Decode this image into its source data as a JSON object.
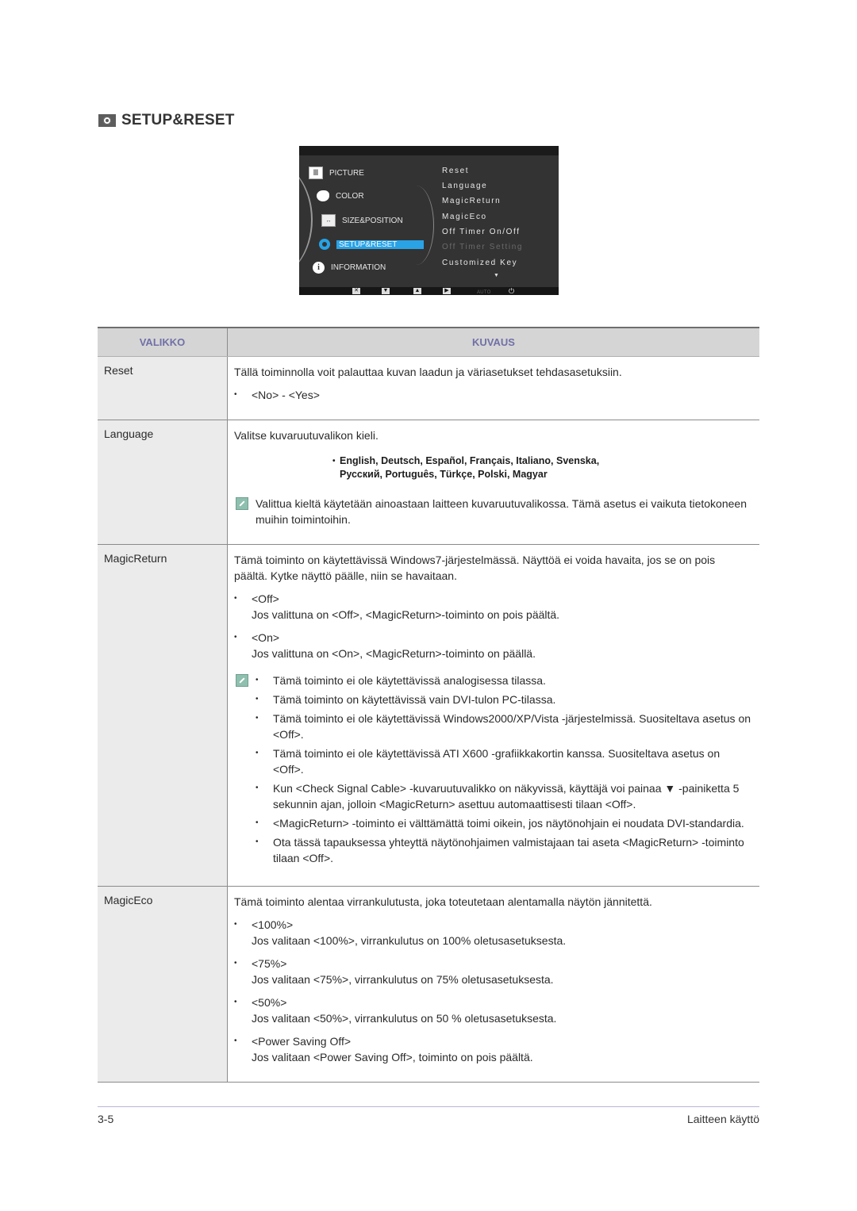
{
  "section": {
    "icon": "setup-gear-icon",
    "title": "SETUP&RESET"
  },
  "osd": {
    "menu": [
      {
        "label": "PICTURE",
        "icon": "picture-icon"
      },
      {
        "label": "COLOR",
        "icon": "palette-icon"
      },
      {
        "label": "SIZE&POSITION",
        "icon": "size-position-icon"
      },
      {
        "label": "SETUP&RESET",
        "icon": "gear-icon",
        "selected": true
      },
      {
        "label": "INFORMATION",
        "icon": "info-icon"
      }
    ],
    "submenu": [
      {
        "label": "Reset"
      },
      {
        "label": "Language"
      },
      {
        "label": "MagicReturn"
      },
      {
        "label": "MagicEco"
      },
      {
        "label": "Off Timer On/Off"
      },
      {
        "label": "Off Timer Setting",
        "disabled": true
      },
      {
        "label": "Customized Key"
      }
    ],
    "more_indicator": "▼",
    "buttons": {
      "exit": "✕",
      "down": "▼",
      "up": "▲",
      "enter": "▶",
      "auto": "AUTO",
      "power": "⏻"
    }
  },
  "table": {
    "headers": {
      "menu": "VALIKKO",
      "description": "KUVAUS"
    },
    "rows": {
      "reset": {
        "name": "Reset",
        "desc": "Tällä toiminnolla voit palauttaa kuvan laadun ja väriasetukset tehdasasetuksiin.",
        "options": [
          "<No> - <Yes>"
        ]
      },
      "language": {
        "name": "Language",
        "desc": "Valitse kuvaruutuvalikon kieli.",
        "languages_line1": "English, Deutsch, Español, Français, Italiano, Svenska,",
        "languages_line2": "Русский, Português, Türkçe, Polski, Magyar",
        "note": "Valittua kieltä käytetään ainoastaan laitteen kuvaruutuvalikossa. Tämä asetus ei vaikuta tietokoneen muihin toimintoihin."
      },
      "magicreturn": {
        "name": "MagicReturn",
        "desc": "Tämä toiminto on käytettävissä Windows7-järjestelmässä. Näyttöä ei voida havaita, jos se on pois päältä. Kytke näyttö päälle, niin se havaitaan.",
        "options": [
          {
            "label": "<Off>",
            "text": "Jos valittuna on <Off>, <MagicReturn>-toiminto on pois päältä."
          },
          {
            "label": "<On>",
            "text": "Jos valittuna on <On>, <MagicReturn>-toiminto on päällä."
          }
        ],
        "notes": [
          "Tämä toiminto ei ole käytettävissä analogisessa tilassa.",
          "Tämä toiminto on käytettävissä vain DVI-tulon PC-tilassa.",
          "Tämä toiminto ei ole käytettävissä Windows2000/XP/Vista -järjestelmissä. Suositeltava asetus on <Off>.",
          "Tämä toiminto ei ole käytettävissä ATI X600 -grafiikkakortin kanssa. Suositeltava asetus on <Off>.",
          "Kun <Check Signal Cable> -kuvaruutuvalikko on näkyvissä, käyttäjä voi painaa ▼ -painiketta 5 sekunnin ajan, jolloin <MagicReturn> asettuu automaattisesti tilaan <Off>.",
          "<MagicReturn> -toiminto ei välttämättä toimi oikein, jos näytönohjain ei noudata DVI-standardia.",
          "Ota tässä tapauksessa yhteyttä näytönohjaimen valmistajaan tai aseta <MagicReturn> -toiminto tilaan <Off>."
        ]
      },
      "magiceco": {
        "name": "MagicEco",
        "desc": "Tämä toiminto alentaa virrankulutusta, joka toteutetaan alentamalla näytön jännitettä.",
        "options": [
          {
            "label": "<100%>",
            "text": "Jos valitaan <100%>, virrankulutus on 100% oletusasetuksesta."
          },
          {
            "label": "<75%>",
            "text": "Jos valitaan <75%>, virrankulutus on 75% oletusasetuksesta."
          },
          {
            "label": "<50%>",
            "text": "Jos valitaan <50%>, virrankulutus on 50 % oletusasetuksesta."
          },
          {
            "label": "<Power Saving Off>",
            "text": "Jos valitaan <Power Saving Off>, toiminto on pois päältä."
          }
        ]
      }
    }
  },
  "footer": {
    "page_number": "3-5",
    "chapter": "Laitteen käyttö"
  },
  "glyphs": {
    "bullet": "•"
  }
}
